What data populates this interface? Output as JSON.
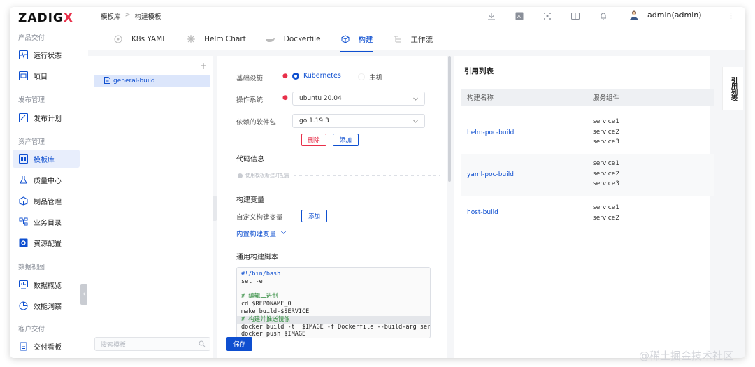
{
  "brand": {
    "logo_main": "ZADIG",
    "logo_x": "X"
  },
  "sidebar": {
    "sections": [
      {
        "title": "产品交付",
        "items": [
          {
            "label": "运行状态",
            "icon": "pulse-icon"
          },
          {
            "label": "项目",
            "icon": "project-icon"
          }
        ]
      },
      {
        "title": "发布管理",
        "items": [
          {
            "label": "发布计划",
            "icon": "plan-icon"
          }
        ]
      },
      {
        "title": "资产管理",
        "items": [
          {
            "label": "模板库",
            "icon": "template-icon",
            "active": true
          },
          {
            "label": "质量中心",
            "icon": "flask-icon"
          },
          {
            "label": "制品管理",
            "icon": "artifact-icon"
          },
          {
            "label": "业务目录",
            "icon": "catalog-icon"
          },
          {
            "label": "资源配置",
            "icon": "gear-icon"
          }
        ]
      },
      {
        "title": "数据视图",
        "items": [
          {
            "label": "数据概览",
            "icon": "chart-icon"
          },
          {
            "label": "效能洞察",
            "icon": "pie-icon"
          }
        ]
      },
      {
        "title": "客户交付",
        "items": [
          {
            "label": "交付看板",
            "icon": "board-icon"
          }
        ]
      }
    ]
  },
  "header": {
    "breadcrumb": [
      "模板库",
      ">",
      "构建模板"
    ],
    "tabs": [
      {
        "label": "K8s YAML",
        "icon": "k8s-icon"
      },
      {
        "label": "Helm Chart",
        "icon": "helm-icon"
      },
      {
        "label": "Dockerfile",
        "icon": "docker-icon"
      },
      {
        "label": "构建",
        "icon": "cube-icon",
        "active": true
      },
      {
        "label": "工作流",
        "icon": "workflow-icon"
      }
    ],
    "user": "admin(admin)"
  },
  "templates": {
    "items": [
      "general-build"
    ],
    "search_placeholder": "搜索模板"
  },
  "form": {
    "infra_label": "基础设施",
    "infra_options": [
      "Kubernetes",
      "主机"
    ],
    "os_label": "操作系统",
    "os_value": "ubuntu 20.04",
    "deps_label": "依赖的软件包",
    "deps_value": "go 1.19.3",
    "delete_label": "删除",
    "add_label": "添加",
    "code_info_title": "代码信息",
    "code_info_hint": "使用模板新建时配置",
    "build_vars_title": "构建变量",
    "custom_vars_label": "自定义构建变量",
    "custom_vars_add": "添加",
    "builtin_vars_link": "内置构建变量",
    "script_title": "通用构建脚本",
    "script_lines": [
      "#!/bin/bash",
      "set -e",
      "",
      "# 编辑二进制",
      "cd $REPONAME_0",
      "make build-$SERVICE",
      "# 构建并推送镜像",
      "docker build -t  $IMAGE -f Dockerfile --build-arg servic",
      "docker push $IMAGE"
    ],
    "save_label": "保存"
  },
  "references": {
    "title": "引用列表",
    "col_name": "构建名称",
    "col_service": "服务组件",
    "rows": [
      {
        "name": "helm-poc-build",
        "services": "service1\nservice2\nservice3"
      },
      {
        "name": "yaml-poc-build",
        "services": "service1\nservice2\nservice3"
      },
      {
        "name": "host-build",
        "services": "service1\nservice2"
      }
    ],
    "side_tab": "引用列表"
  },
  "watermark": "@稀土掘金技术社区"
}
